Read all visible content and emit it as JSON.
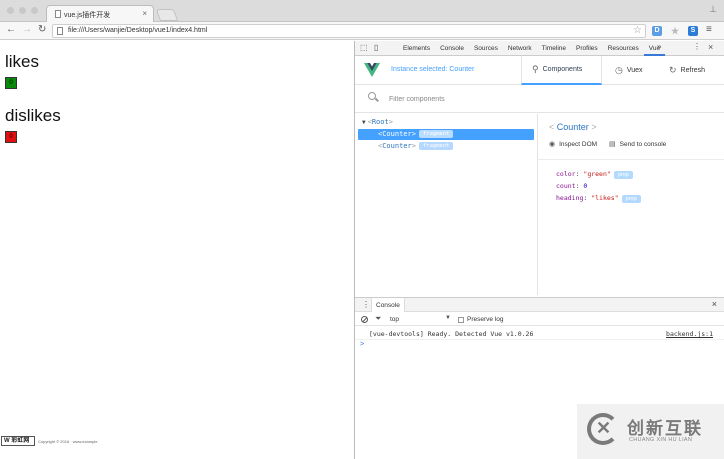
{
  "browser": {
    "tab_title": "vue.js插件开发",
    "url": "file:///Users/wanjie/Desktop/vue1/index4.html",
    "ext_badges": [
      "D",
      "★",
      "S"
    ]
  },
  "page": {
    "counters": [
      {
        "heading": "likes",
        "count": "0",
        "color": "#0a8a0a"
      },
      {
        "heading": "dislikes",
        "count": "0",
        "color": "#e01010"
      }
    ],
    "footer_logo": "W 彩虹网",
    "footer_text": "Copyright © 2016 · www.example"
  },
  "devtools": {
    "tabs": [
      "Elements",
      "Console",
      "Sources",
      "Network",
      "Timeline",
      "Profiles",
      "Resources",
      "Vue"
    ],
    "active_tab": "Vue",
    "more": "»",
    "vue": {
      "instance_selected": "Instance selected: Counter",
      "nav": {
        "components": "Components",
        "vuex": "Vuex",
        "refresh": "Refresh"
      },
      "filter_placeholder": "Filter components",
      "tree": {
        "root": "Root",
        "children": [
          {
            "name": "Counter",
            "badge": "fragment",
            "selected": true
          },
          {
            "name": "Counter",
            "badge": "fragment",
            "selected": false
          }
        ]
      },
      "inspector": {
        "title": "Counter",
        "inspect_dom": "Inspect DOM",
        "send_to_console": "Send to console",
        "props": [
          {
            "key": "color",
            "value": "\"green\"",
            "badge": "prop"
          },
          {
            "key": "count",
            "value": "0",
            "badge": ""
          },
          {
            "key": "heading",
            "value": "\"likes\"",
            "badge": "prop"
          }
        ]
      }
    },
    "console": {
      "tab_label": "Console",
      "context": "top",
      "preserve_log": "Preserve log",
      "message": "[vue-devtools] Ready. Detected Vue v1.0.26",
      "source": "backend.js:1",
      "prompt": ">"
    }
  },
  "watermark": {
    "cn": "创新互联",
    "en": "CHUANG XIN HU LIAN"
  },
  "colors": {
    "vue_accent": "#44a1ff",
    "likes_box": "#0a8a0a",
    "dislikes_box": "#e01010"
  }
}
